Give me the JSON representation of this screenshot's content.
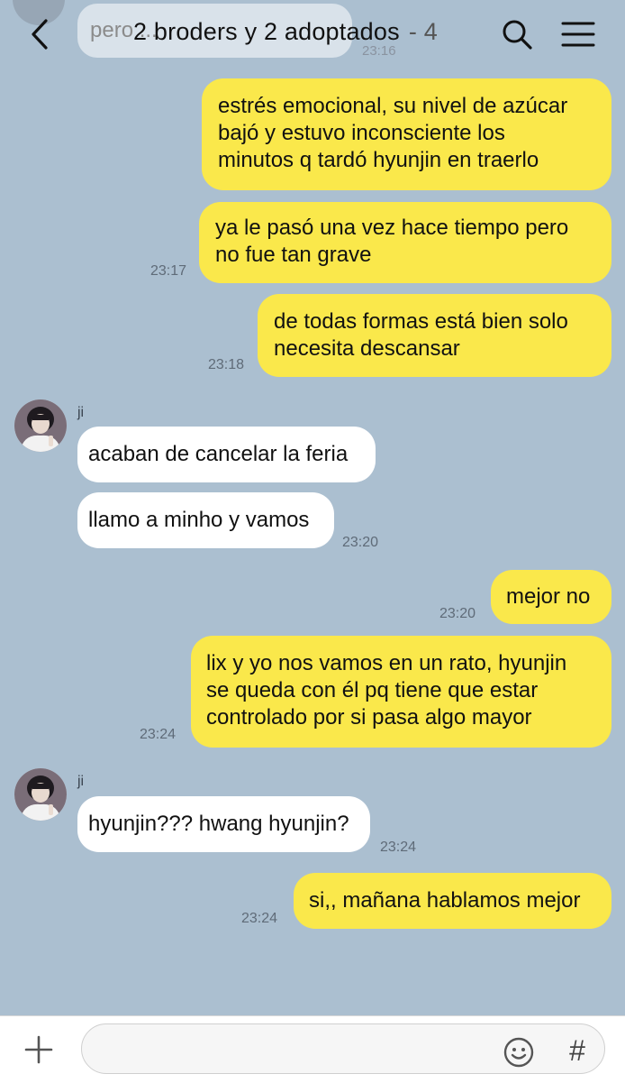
{
  "header": {
    "title": "2 broders y 2 adoptados",
    "member_count": "- 4",
    "back_icon": "chevron-left-icon",
    "search_icon": "search-icon",
    "menu_icon": "menu-icon"
  },
  "previous_fragment": {
    "text": "pero ...",
    "time": "23:16"
  },
  "messages": [
    {
      "from": "me",
      "lines": [
        "estrés emocional, su nivel de azúcar",
        "bajó y estuvo inconsciente los",
        "minutos q tardó hyunjin en traerlo"
      ],
      "time": ""
    },
    {
      "from": "me",
      "lines": [
        "ya le pasó una vez hace tiempo pero",
        "no fue tan grave"
      ],
      "time": "23:17"
    },
    {
      "from": "me",
      "lines": [
        "de todas formas está bien solo",
        "necesita descansar"
      ],
      "time": "23:18"
    },
    {
      "from": "ji",
      "sender": "ji",
      "lines": [
        "acaban de cancelar la feria"
      ],
      "time": ""
    },
    {
      "from": "ji",
      "lines": [
        "llamo a minho y vamos"
      ],
      "time": "23:20"
    },
    {
      "from": "me",
      "lines": [
        "mejor no"
      ],
      "time": "23:20"
    },
    {
      "from": "me",
      "lines": [
        "lix y yo nos vamos en un rato, hyunjin",
        "se queda con él pq tiene que estar",
        "controlado por si pasa algo mayor"
      ],
      "time": "23:24"
    },
    {
      "from": "ji",
      "sender": "ji",
      "lines": [
        "hyunjin??? hwang hyunjin?"
      ],
      "time": "23:24"
    },
    {
      "from": "me",
      "lines": [
        "si,, mañana hablamos mejor"
      ],
      "time": "23:24"
    }
  ],
  "footer": {
    "input_value": "",
    "input_placeholder": "",
    "plus_icon": "plus-icon",
    "emoji_icon": "emoji-icon",
    "hash_label": "#"
  },
  "colors": {
    "background": "#abbfd0",
    "my_bubble": "#fae84b",
    "their_bubble": "#ffffff"
  }
}
